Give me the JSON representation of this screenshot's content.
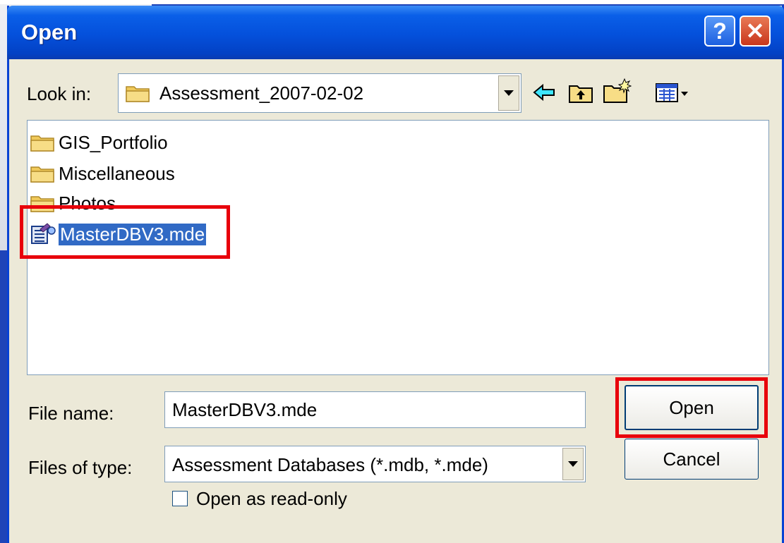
{
  "dialog": {
    "title": "Open",
    "help_label": "?",
    "close_label": "✕"
  },
  "look_in": {
    "label": "Look in:",
    "value": "Assessment_2007-02-02"
  },
  "toolbar": {
    "icons": [
      "back-arrow-icon",
      "up-folder-icon",
      "new-folder-icon",
      "view-menu-icon"
    ]
  },
  "files": [
    {
      "name": "GIS_Portfolio",
      "type": "folder"
    },
    {
      "name": "Miscellaneous",
      "type": "folder"
    },
    {
      "name": "Photos",
      "type": "folder"
    },
    {
      "name": "MasterDBV3.mde",
      "type": "database",
      "selected": true
    }
  ],
  "file_name": {
    "label": "File name:",
    "value": "MasterDBV3.mde"
  },
  "files_of_type": {
    "label": "Files of type:",
    "value": "Assessment Databases (*.mdb, *.mde)"
  },
  "buttons": {
    "open": "Open",
    "cancel": "Cancel"
  },
  "read_only": {
    "label": "Open as read-only",
    "checked": false
  },
  "colors": {
    "highlight": "#e8000b",
    "selection": "#316ac5",
    "titlebar": "#0450db"
  }
}
